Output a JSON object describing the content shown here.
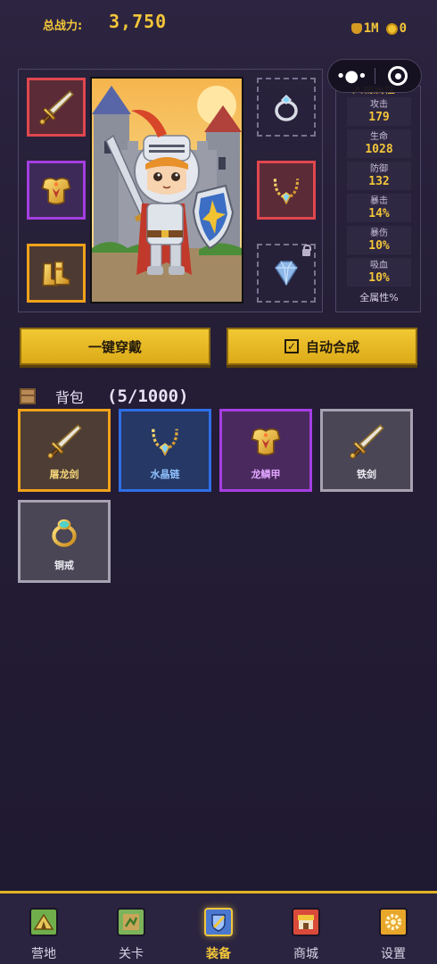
{
  "header": {
    "power_label": "总战力:",
    "power_value": "3,750",
    "gold": "1M",
    "gems": "0"
  },
  "equipment": {
    "slots": [
      {
        "slot": "weapon",
        "icon": "sword-icon",
        "rarity": "red",
        "color": "#e0474f"
      },
      {
        "slot": "armor",
        "icon": "armor-icon",
        "rarity": "purple",
        "color": "#a43ee0"
      },
      {
        "slot": "boots",
        "icon": "boots-icon",
        "rarity": "orange",
        "color": "#f1a21b"
      },
      {
        "slot": "ring",
        "icon": "ring-icon",
        "state": "empty"
      },
      {
        "slot": "necklace",
        "icon": "necklace-icon",
        "rarity": "red",
        "color": "#e0474f"
      },
      {
        "slot": "gem",
        "icon": "gem-icon",
        "state": "locked"
      }
    ]
  },
  "attributes": {
    "title": "人物属性",
    "items": [
      {
        "label": "攻击",
        "value": "179"
      },
      {
        "label": "生命",
        "value": "1028"
      },
      {
        "label": "防御",
        "value": "132"
      },
      {
        "label": "暴击",
        "value": "14%"
      },
      {
        "label": "暴伤",
        "value": "10%"
      },
      {
        "label": "吸血",
        "value": "10%"
      }
    ],
    "more_label": "全属性%"
  },
  "actions": {
    "equip_all": "一键穿戴",
    "auto_merge": "自动合成",
    "auto_merge_checked": true
  },
  "backpack": {
    "label": "背包",
    "count": "(5/1000)",
    "items": [
      {
        "name": "屠龙剑",
        "icon": "sword-icon",
        "rarity": "orange"
      },
      {
        "name": "水晶链",
        "icon": "necklace-icon",
        "rarity": "blue"
      },
      {
        "name": "龙鳞甲",
        "icon": "armor-icon",
        "rarity": "purple"
      },
      {
        "name": "铁剑",
        "icon": "sword-icon",
        "rarity": "gray"
      },
      {
        "name": "铜戒",
        "icon": "ring-icon",
        "rarity": "gray"
      }
    ]
  },
  "nav": {
    "items": [
      {
        "label": "营地",
        "icon": "camp-icon"
      },
      {
        "label": "关卡",
        "icon": "map-icon"
      },
      {
        "label": "装备",
        "icon": "equipment-icon",
        "active": true
      },
      {
        "label": "商城",
        "icon": "shop-icon"
      },
      {
        "label": "设置",
        "icon": "settings-gear-icon"
      }
    ]
  },
  "colors": {
    "accent": "#f3c63a",
    "background": "#241d35",
    "rarity_orange": "#f1a21b",
    "rarity_blue": "#2e6fe6",
    "rarity_purple": "#a63ee2",
    "rarity_gray": "#a7a2b2",
    "rarity_red": "#e0474f"
  }
}
